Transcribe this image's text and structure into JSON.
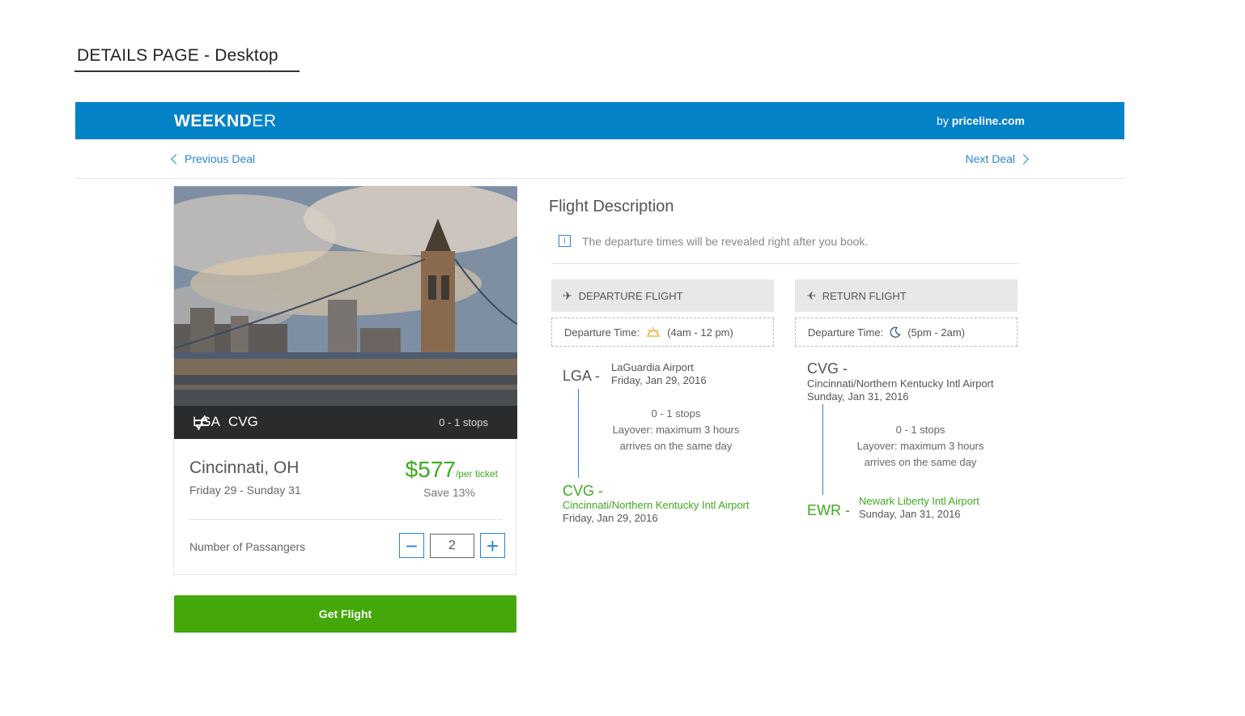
{
  "page_label": "DETAILS PAGE - Desktop",
  "header": {
    "brand_bold": "WEEKND",
    "brand_light": "ER",
    "by_prefix": "by ",
    "by_name": "priceline.com",
    "color": "#0482c8"
  },
  "nav": {
    "previous": "Previous Deal",
    "next": "Next Deal"
  },
  "deal": {
    "origin": "LGA",
    "destination": "CVG",
    "route_icon": "round-trip-arrows-icon",
    "stops": "0 - 1 stops",
    "city": "Cincinnati, OH",
    "dates": "Friday 29 - Sunday 31",
    "price": "$577",
    "price_unit": "/per ticket",
    "save": "Save 13%",
    "passengers_label": "Number of Passangers",
    "passengers": "2",
    "cta": "Get Flight",
    "accent": "#45a80a"
  },
  "flight_description": {
    "title": "Flight Description",
    "info": "The departure times will be revealed right after you book.",
    "departure": {
      "header": "DEPARTURE FLIGHT",
      "time_label": "Departure Time:",
      "time_icon": "sunrise-icon",
      "time_range": "(4am - 12 pm)",
      "from_code": "LGA -",
      "from_airport": "LaGuardia Airport",
      "from_date": "Friday, Jan 29, 2016",
      "stops": "0 - 1 stops",
      "layover": "Layover: maximum 3 hours",
      "arrival_note": "arrives on the same day",
      "to_code": "CVG -",
      "to_airport": "Cincinnati/Northern Kentucky Intl Airport",
      "to_date": "Friday, Jan 29, 2016"
    },
    "return": {
      "header": "RETURN FLIGHT",
      "time_label": "Departure Time:",
      "time_icon": "moon-icon",
      "time_range": "(5pm - 2am)",
      "from_code": "CVG -",
      "from_airport": "Cincinnati/Northern Kentucky Intl Airport",
      "from_date": "Sunday, Jan 31, 2016",
      "stops": "0 - 1 stops",
      "layover": "Layover: maximum 3 hours",
      "arrival_note": "arrives on the same day",
      "to_code": "EWR -",
      "to_airport": "Newark Liberty Intl Airport",
      "to_date": "Sunday, Jan 31, 2016"
    }
  }
}
